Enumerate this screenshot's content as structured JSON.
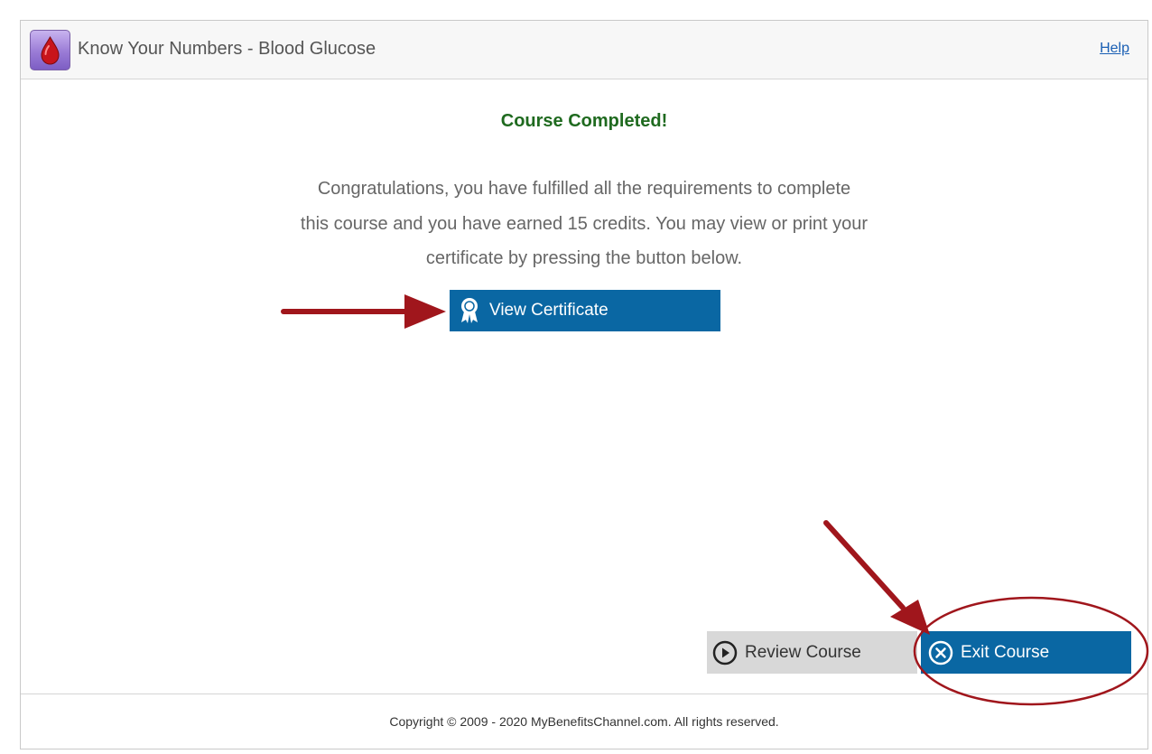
{
  "header": {
    "app_title": "Know Your Numbers - Blood Glucose",
    "logo_icon": "blood-drop-icon",
    "help_link": "Help"
  },
  "main": {
    "status_heading": "Course Completed!",
    "message_lines": [
      "Congratulations, you have fulfilled all the requirements to complete",
      "this course and you have earned 15 credits. You may view or print your",
      "certificate by pressing the button below."
    ],
    "view_certificate_button": {
      "label": "View Certificate",
      "icon": "ribbon-award-icon"
    }
  },
  "actions": {
    "review_course_button": {
      "label": "Review Course",
      "icon": "play-circle-icon"
    },
    "exit_course_button": {
      "label": "Exit Course",
      "icon": "close-circle-icon"
    }
  },
  "footer": {
    "copyright": "Copyright © 2009 - 2020 MyBenefitsChannel.com. All rights reserved."
  },
  "colors": {
    "primary_button": "#0a67a3",
    "secondary_button": "#d8d8d8",
    "success_heading": "#1f6a1f",
    "annotation_arrow": "#a0161c",
    "link": "#1a5fb4"
  }
}
